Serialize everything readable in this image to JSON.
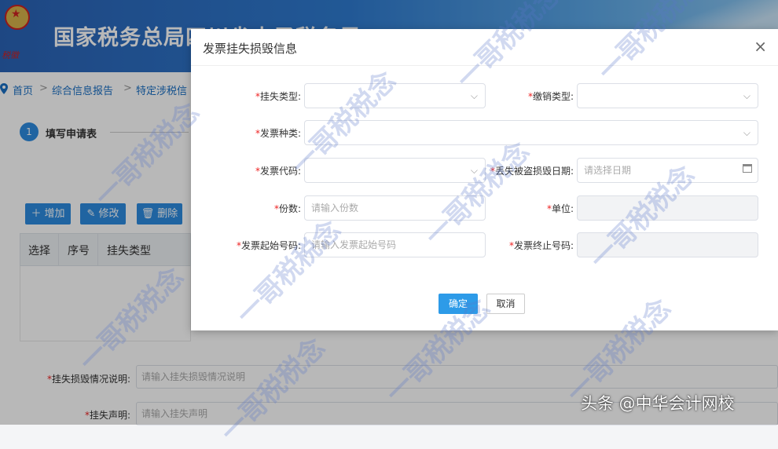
{
  "header": {
    "site_title": "国家税务总局四川省电子税务局",
    "emblem_sign": "税徽"
  },
  "breadcrumb": {
    "items": [
      "首页",
      "综合信息报告",
      "特定涉税信"
    ],
    "separator": ">"
  },
  "steps": {
    "step1_number": "1",
    "step1_label": "填写申请表"
  },
  "toolbar": {
    "add": "增加",
    "edit": "修改",
    "delete": "删除"
  },
  "table": {
    "headers": [
      "选择",
      "序号",
      "挂失类型"
    ]
  },
  "bottom_form": {
    "desc_label": "挂失损毁情况说明:",
    "desc_placeholder": "请输入挂失损毁情况说明",
    "statement_label": "挂失声明:",
    "statement_placeholder": "请输入挂失声明"
  },
  "dialog": {
    "title": "发票挂失损毁信息",
    "close_symbol": "×",
    "required_mark": "*",
    "fields": {
      "loss_type": {
        "label": "挂失类型:",
        "value": ""
      },
      "cancel_type": {
        "label": "缴销类型:",
        "value": ""
      },
      "invoice_kind": {
        "label": "发票种类:",
        "value": ""
      },
      "invoice_code": {
        "label": "发票代码:",
        "value": ""
      },
      "loss_date": {
        "label": "丢失被盗损毁日期:",
        "placeholder": "请选择日期"
      },
      "copies": {
        "label": "份数:",
        "placeholder": "请输入份数"
      },
      "unit": {
        "label": "单位:",
        "value": ""
      },
      "start_no": {
        "label": "发票起始号码:",
        "placeholder": "请输入发票起始号码"
      },
      "end_no": {
        "label": "发票终止号码:",
        "value": ""
      }
    },
    "confirm": "确定",
    "cancel": "取消"
  },
  "watermark_text": "一哥税税念",
  "credit": "头条 @中华会计网校",
  "colors": {
    "header_blue": "#2a63b6",
    "primary": "#2d8be0",
    "required": "#e22222"
  },
  "icons": {
    "chevron": "chevron-down-icon",
    "calendar": "calendar-icon",
    "close": "close-icon"
  }
}
